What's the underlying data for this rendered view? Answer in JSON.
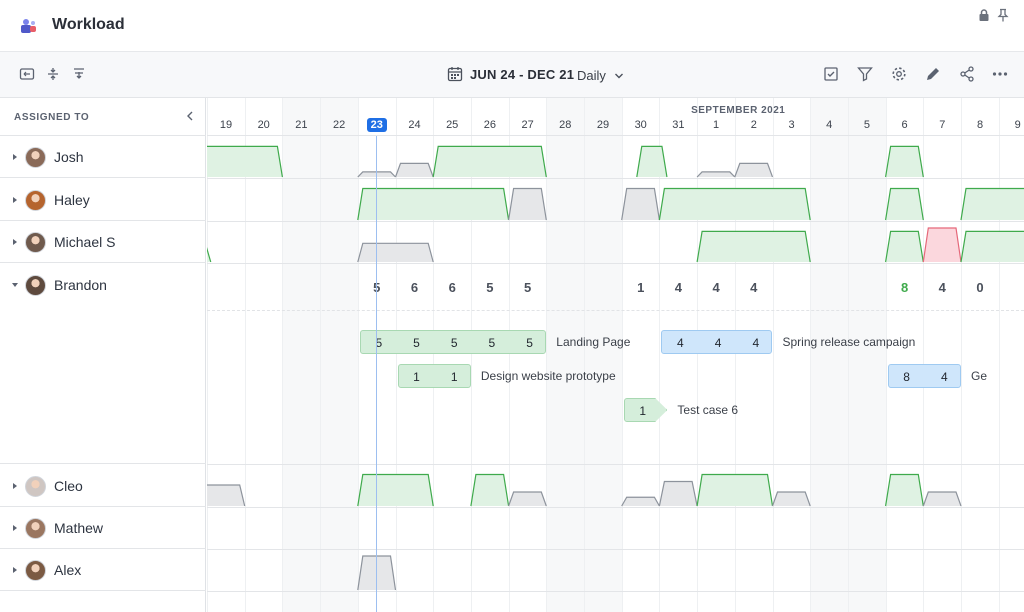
{
  "app": {
    "title": "Workload",
    "logo_icon": "app-logo-icon",
    "title_icons": [
      "lock-icon",
      "pin-icon"
    ]
  },
  "toolbar": {
    "left_icons": [
      "collapse-view-icon",
      "compress-rows-icon",
      "expand-rows-icon"
    ],
    "date_range": "JUN 24 - DEC 21",
    "view_mode": "Daily",
    "right_icons": [
      "check-square-icon",
      "filter-icon",
      "gear-icon",
      "pencil-icon",
      "share-icon",
      "more-icon"
    ]
  },
  "sidebar": {
    "header": "ASSIGNED TO",
    "people": [
      {
        "name": "Josh",
        "expanded": false,
        "avatar_color": "#8a6a58"
      },
      {
        "name": "Haley",
        "expanded": false,
        "avatar_color": "#b5642e"
      },
      {
        "name": "Michael S",
        "expanded": false,
        "avatar_color": "#6f5a4d"
      },
      {
        "name": "Brandon",
        "expanded": true,
        "avatar_color": "#5e4a3e"
      },
      {
        "name": "Cleo",
        "expanded": false,
        "avatar_color": "#cfc6c2"
      },
      {
        "name": "Mathew",
        "expanded": false,
        "avatar_color": "#9a7660"
      },
      {
        "name": "Alex",
        "expanded": false,
        "avatar_color": "#7b5a43"
      }
    ]
  },
  "timeline": {
    "month_label": "SEPTEMBER 2021",
    "days": [
      "19",
      "20",
      "21",
      "22",
      "23",
      "24",
      "25",
      "26",
      "27",
      "28",
      "29",
      "30",
      "31",
      "1",
      "2",
      "3",
      "4",
      "5",
      "6",
      "7",
      "8",
      "9"
    ],
    "weekend_indices": [
      2,
      3,
      9,
      10,
      16,
      17
    ],
    "today_index": 4
  },
  "brandon": {
    "daily_totals": [
      {
        "day_index": 4,
        "value": "5"
      },
      {
        "day_index": 5,
        "value": "6"
      },
      {
        "day_index": 6,
        "value": "6"
      },
      {
        "day_index": 7,
        "value": "5"
      },
      {
        "day_index": 8,
        "value": "5"
      },
      {
        "day_index": 11,
        "value": "1"
      },
      {
        "day_index": 12,
        "value": "4"
      },
      {
        "day_index": 13,
        "value": "4"
      },
      {
        "day_index": 14,
        "value": "4"
      },
      {
        "day_index": 18,
        "value": "8",
        "over": true
      },
      {
        "day_index": 19,
        "value": "4"
      },
      {
        "day_index": 20,
        "value": "0"
      }
    ],
    "tasks": [
      {
        "name": "Landing Page",
        "color": "green",
        "start_day_index": 4,
        "values": [
          "5",
          "5",
          "5",
          "5",
          "5"
        ],
        "lane": 0
      },
      {
        "name": "Spring release campaign",
        "color": "blue",
        "start_day_index": 12,
        "values": [
          "4",
          "4",
          "4"
        ],
        "lane": 0
      },
      {
        "name": "Design website prototype",
        "color": "green",
        "start_day_index": 5,
        "values": [
          "1",
          "1"
        ],
        "lane": 1
      },
      {
        "name": "Ge",
        "color": "blue",
        "start_day_index": 18,
        "values": [
          "8",
          "4"
        ],
        "lane": 1
      },
      {
        "name": "Test case 6",
        "color": "green",
        "start_day_index": 11,
        "values": [
          "1"
        ],
        "lane": 2,
        "arrow": true
      }
    ]
  },
  "colors": {
    "accent": "#1f6fe5",
    "ok": "#3faa4c",
    "over": "#e5687a",
    "scheduled": "#d5eedb",
    "other": "#e4e5e7"
  }
}
